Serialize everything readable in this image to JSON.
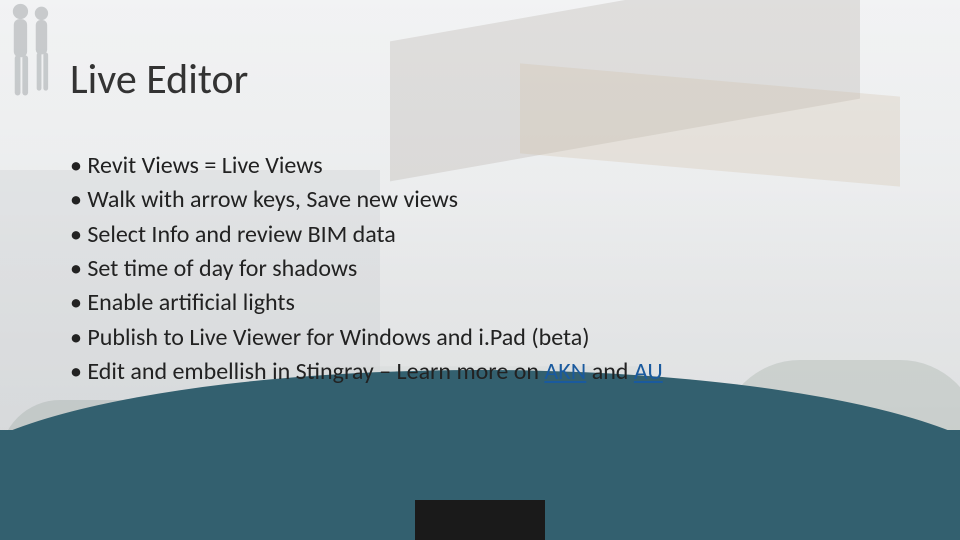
{
  "slide": {
    "title": "Live Editor",
    "bullets": [
      {
        "pre": "Revit Views = Live Views"
      },
      {
        "pre": "Walk with arrow keys, Save new views"
      },
      {
        "pre": "Select Info and review BIM data"
      },
      {
        "pre": "Set time of day for shadows"
      },
      {
        "pre": "Enable artificial lights"
      },
      {
        "pre": "Publish to Live Viewer for Windows and i.Pad (beta)"
      },
      {
        "pre": "Edit and embellish in Stingray – Learn more on ",
        "link1": "AKN",
        "mid": " and ",
        "link2": "AU"
      }
    ],
    "accent_color": "#1a5a9e",
    "footer_color": "#33606f"
  }
}
